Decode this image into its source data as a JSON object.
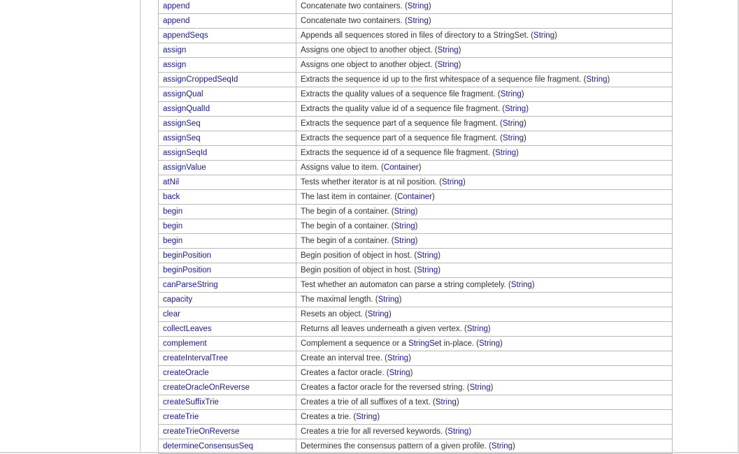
{
  "colors": {
    "link": "#1a1a8c",
    "text": "#333333",
    "border": "#b9b9b9"
  },
  "rows": [
    {
      "name": "append",
      "desc": "Concatenate two containers.",
      "ref": "String"
    },
    {
      "name": "append",
      "desc": "Concatenate two containers.",
      "ref": "String"
    },
    {
      "name": "appendSeqs",
      "desc": "Appends all sequences stored in files of directory to a StringSet.",
      "ref": "String"
    },
    {
      "name": "assign",
      "desc": "Assigns one object to another object.",
      "ref": "String"
    },
    {
      "name": "assign",
      "desc": "Assigns one object to another object.",
      "ref": "String"
    },
    {
      "name": "assignCroppedSeqId",
      "desc": "Extracts the sequence id up to the first whitespace of a sequence file fragment.",
      "ref": "String"
    },
    {
      "name": "assignQual",
      "desc": "Extracts the quality values of a sequence file fragment.",
      "ref": "String"
    },
    {
      "name": "assignQualId",
      "desc": "Extracts the quality value id of a sequence file fragment.",
      "ref": "String"
    },
    {
      "name": "assignSeq",
      "desc": "Extracts the sequence part of a sequence file fragment.",
      "ref": "String"
    },
    {
      "name": "assignSeq",
      "desc": "Extracts the sequence part of a sequence file fragment.",
      "ref": "String"
    },
    {
      "name": "assignSeqId",
      "desc": "Extracts the sequence id of a sequence file fragment.",
      "ref": "String"
    },
    {
      "name": "assignValue",
      "desc": "Assigns value to item.",
      "ref": "Container"
    },
    {
      "name": "atNil",
      "desc": "Tests whether iterator is at nil position.",
      "ref": "String"
    },
    {
      "name": "back",
      "desc": "The last item in container.",
      "ref": "Container"
    },
    {
      "name": "begin",
      "desc": "The begin of a container.",
      "ref": "String"
    },
    {
      "name": "begin",
      "desc": "The begin of a container.",
      "ref": "String"
    },
    {
      "name": "begin",
      "desc": "The begin of a container.",
      "ref": "String"
    },
    {
      "name": "beginPosition",
      "desc": "Begin position of object in host.",
      "ref": "String"
    },
    {
      "name": "beginPosition",
      "desc": "Begin position of object in host.",
      "ref": "String"
    },
    {
      "name": "canParseString",
      "desc": "Test whether an automaton can parse a string completely.",
      "ref": "String"
    },
    {
      "name": "capacity",
      "desc": "The maximal length.",
      "ref": "String"
    },
    {
      "name": "clear",
      "desc": "Resets an object.",
      "ref": "String"
    },
    {
      "name": "collectLeaves",
      "desc": "Returns all leaves underneath a given vertex.",
      "ref": "String"
    },
    {
      "name": "complement",
      "desc_pre": "Complement a sequence or a ",
      "desc_link": "StringSet",
      "desc_post": " in-place.",
      "ref": "String"
    },
    {
      "name": "createIntervalTree",
      "desc": "Create an interval tree.",
      "ref": "String"
    },
    {
      "name": "createOracle",
      "desc": "Creates a factor oracle.",
      "ref": "String"
    },
    {
      "name": "createOracleOnReverse",
      "desc": "Creates a factor oracle for the reversed string.",
      "ref": "String"
    },
    {
      "name": "createSuffixTrie",
      "desc": "Creates a trie of all suffixes of a text.",
      "ref": "String"
    },
    {
      "name": "createTrie",
      "desc": "Creates a trie.",
      "ref": "String"
    },
    {
      "name": "createTrieOnReverse",
      "desc": "Creates a trie for all reversed keywords.",
      "ref": "String"
    },
    {
      "name": "determineConsensusSeq",
      "desc": "Determines the consensus pattern of a given profile.",
      "ref": "String"
    }
  ]
}
